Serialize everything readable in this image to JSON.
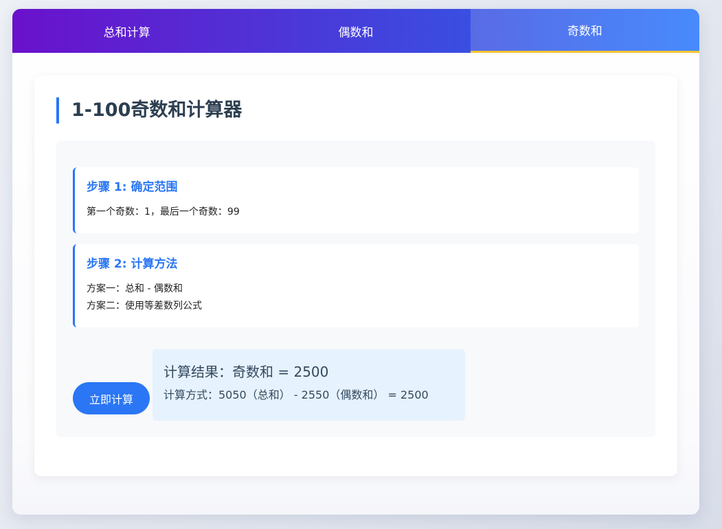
{
  "tabs": [
    {
      "label": "总和计算",
      "active": false
    },
    {
      "label": "偶数和",
      "active": false
    },
    {
      "label": "奇数和",
      "active": true
    }
  ],
  "main": {
    "title": "1-100奇数和计算器",
    "steps": [
      {
        "title": "步骤 1: 确定范围",
        "lines": [
          "第一个奇数：1，最后一个奇数：99"
        ]
      },
      {
        "title": "步骤 2: 计算方法",
        "lines": [
          "方案一：总和 - 偶数和",
          "方案二：使用等差数列公式"
        ]
      }
    ],
    "calc_button_label": "立即计算",
    "result": {
      "main": "计算结果：奇数和 = 2500",
      "detail": "计算方式：5050（总和） - 2550（偶数和） = 2500"
    }
  },
  "colors": {
    "accent": "#2a76f5",
    "tab_gradient_start": "#6a11cb",
    "tab_gradient_end": "#2575fc",
    "active_tab_indicator": "#f7c531",
    "result_background": "#e6f2fd"
  }
}
